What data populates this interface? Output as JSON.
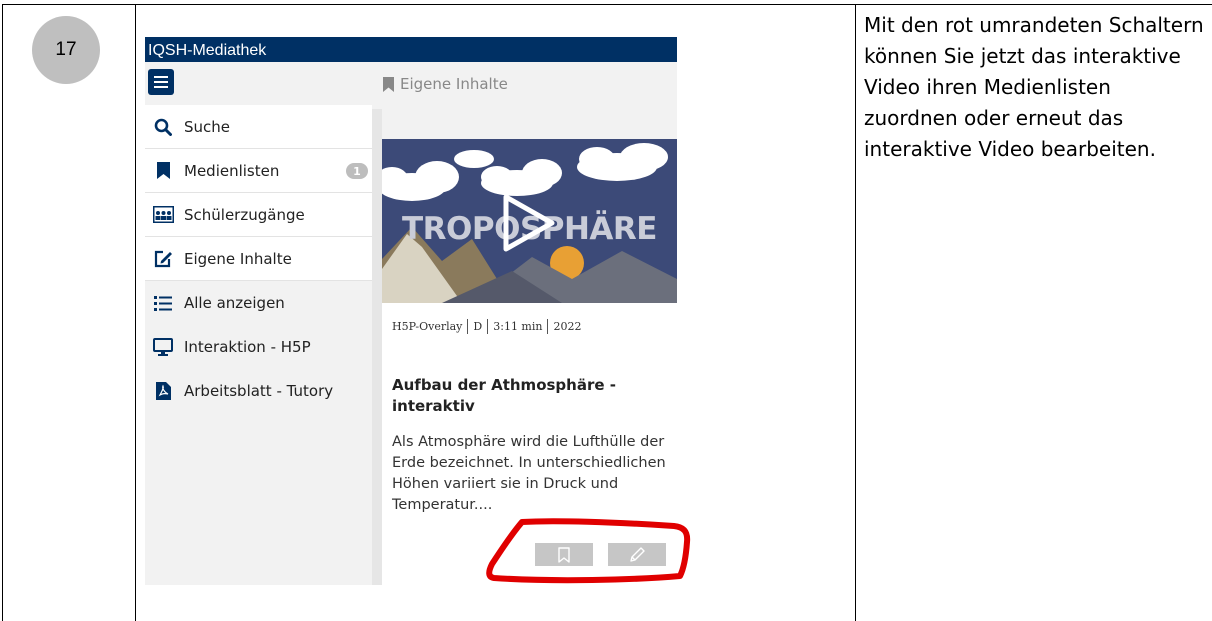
{
  "step": {
    "number": "17"
  },
  "instruction": {
    "text": "Mit den rot umrandeten Schaltern können Sie jetzt das interaktive Video ihren Medienlisten zuordnen oder erneut das interaktive Video bearbeiten."
  },
  "app": {
    "title": "IQSH-Mediathek",
    "menu_icon": "hamburger-menu-icon",
    "bar_title": "Eigene Inhalte",
    "brand_color": "#003064",
    "sidebar": {
      "items": [
        {
          "label": "Suche",
          "icon": "search-icon"
        },
        {
          "label": "Medienlisten",
          "icon": "bookmark-icon",
          "badge": "1"
        },
        {
          "label": "Schülerzugänge",
          "icon": "users-grid-icon"
        },
        {
          "label": "Eigene Inhalte",
          "icon": "edit-square-icon"
        },
        {
          "label": "Alle anzeigen",
          "icon": "list-icon"
        },
        {
          "label": "Interaktion - H5P",
          "icon": "monitor-icon"
        },
        {
          "label": "Arbeitsblatt - Tutory",
          "icon": "pdf-file-icon"
        }
      ]
    },
    "card": {
      "thumbnail_text": "TROPOSPHÄRE",
      "thumbnail_icon": "play-icon",
      "meta": [
        "H5P-Overlay",
        "D",
        "3:11 min",
        "2022"
      ],
      "title": "Aufbau der Athmosphäre - interaktiv",
      "description": "Als Atmosphäre wird die Lufthülle der Erde bezeichnet. In unterschiedlichen Höhen variiert sie in Druck und Temperatur....",
      "buttons": [
        {
          "icon": "bookmark-outline-icon"
        },
        {
          "icon": "pencil-icon"
        }
      ]
    }
  },
  "highlight_color": "#e00000"
}
